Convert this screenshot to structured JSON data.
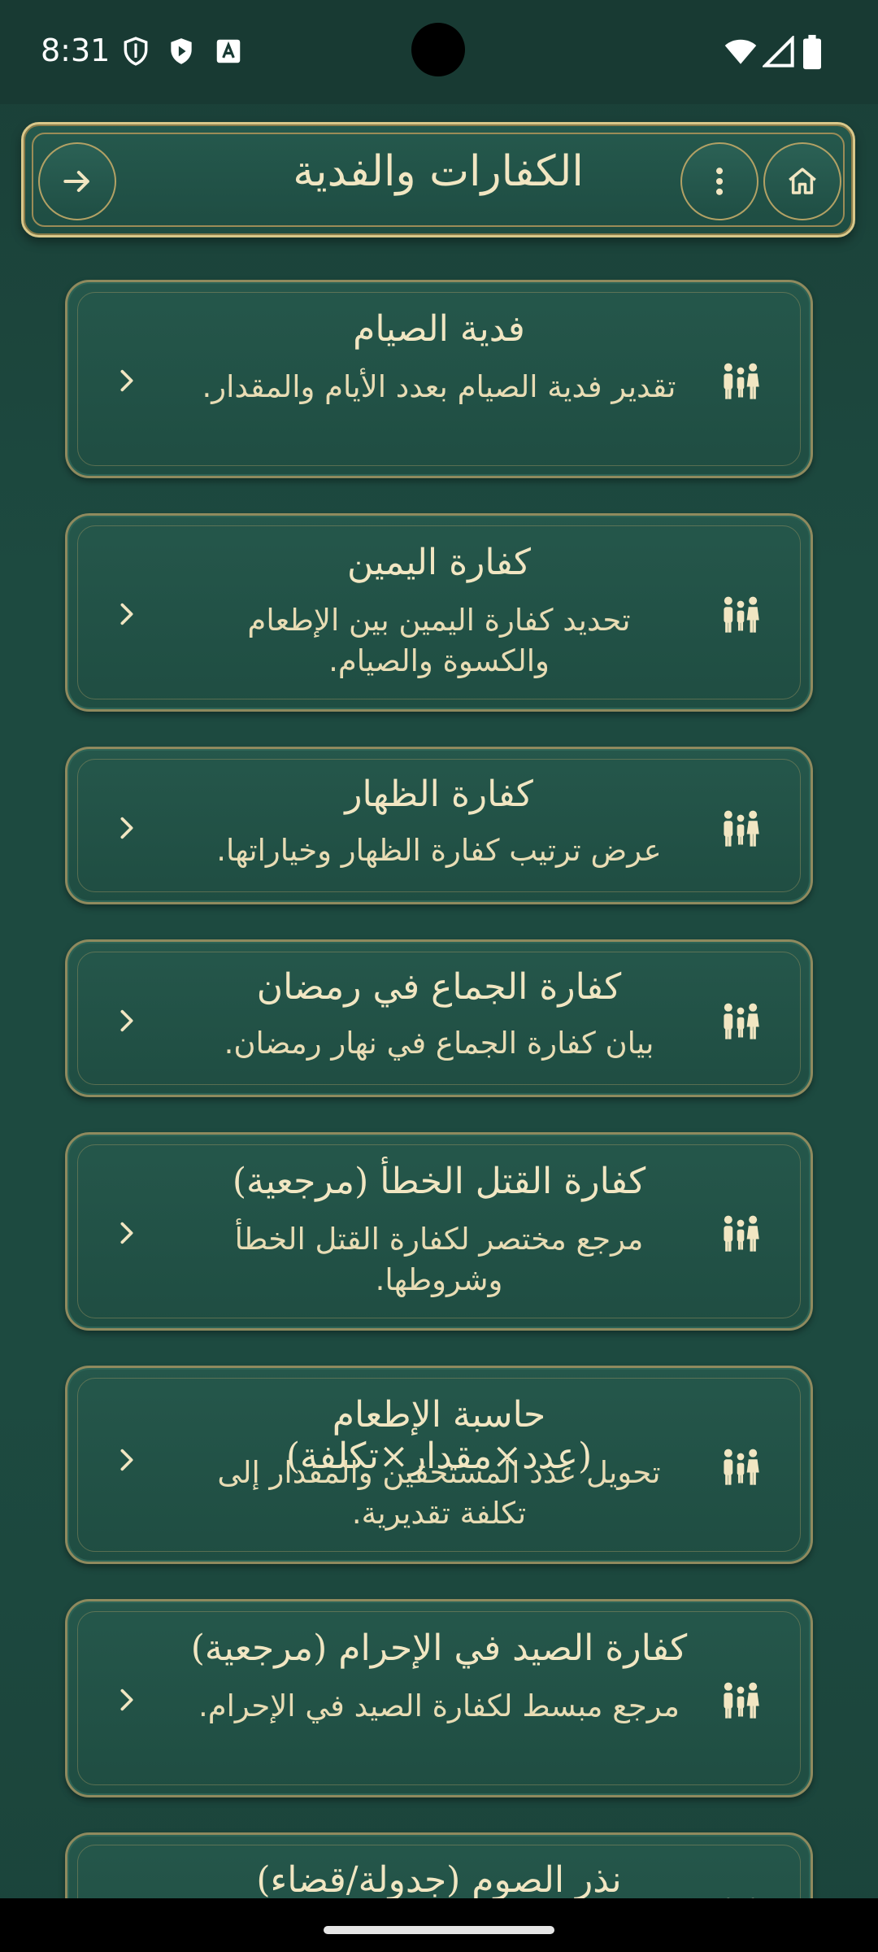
{
  "status_bar": {
    "time": "8:31",
    "icons": [
      "shield-icon",
      "play-protect-icon",
      "font-icon",
      "wifi-icon",
      "signal-icon",
      "battery-icon"
    ]
  },
  "header": {
    "title": "الكفارات والفدية",
    "back_icon": "arrow-right-icon",
    "menu_icon": "more-vertical-icon",
    "home_icon": "home-icon"
  },
  "items": [
    {
      "title": "فدية الصيام",
      "description": "تقدير فدية الصيام بعدد الأيام والمقدار.",
      "icon": "people-icon"
    },
    {
      "title": "كفارة اليمين",
      "description": "تحديد كفارة اليمين بين الإطعام والكسوة والصيام.",
      "icon": "people-icon"
    },
    {
      "title": "كفارة الظهار",
      "description": "عرض ترتيب كفارة الظهار وخياراتها.",
      "icon": "people-icon"
    },
    {
      "title": "كفارة الجماع في رمضان",
      "description": "بيان كفارة الجماع في نهار رمضان.",
      "icon": "people-icon"
    },
    {
      "title": "كفارة القتل الخطأ (مرجعية)",
      "description": "مرجع مختصر لكفارة القتل الخطأ وشروطها.",
      "icon": "people-icon"
    },
    {
      "title": "حاسبة الإطعام (عدد×مقدار×تكلفة)",
      "description": "تحويل عدد المستحقين والمقدار إلى تكلفة تقديرية.",
      "icon": "people-icon"
    },
    {
      "title": "كفارة الصيد في الإحرام (مرجعية)",
      "description": "مرجع مبسط لكفارة الصيد في الإحرام.",
      "icon": "people-icon"
    },
    {
      "title": "نذر الصوم (جدولة/قضاء)",
      "description": "",
      "icon": "people-icon"
    }
  ],
  "colors": {
    "background": "#1d4a40",
    "gold": "#d9c88a",
    "text": "#f1e6c2"
  }
}
